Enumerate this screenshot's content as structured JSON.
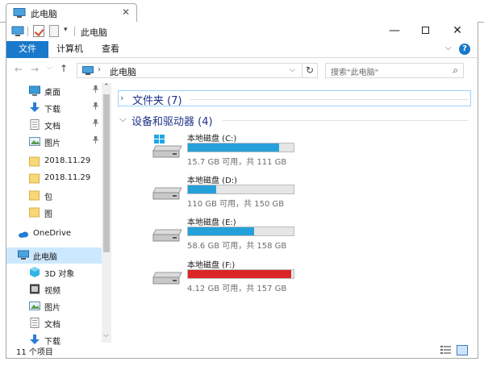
{
  "tab": {
    "title": "此电脑",
    "close": "✕"
  },
  "titlebar": {
    "title": "此电脑",
    "min": "—",
    "close": "✕"
  },
  "ribbon": {
    "tabs": [
      "文件",
      "计算机",
      "查看"
    ],
    "help": "?",
    "collapse": "⌵"
  },
  "address": {
    "back": "←",
    "forward": "→",
    "history": "⌵",
    "up": "↑",
    "separator": "›",
    "path": "此电脑",
    "dropdown": "⌵",
    "refresh": "↻",
    "search_placeholder": "搜索\"此电脑\"",
    "search_icon": "⌕"
  },
  "navpane": {
    "items": [
      {
        "label": "桌面",
        "pinned": true,
        "icon": "desktop-icon"
      },
      {
        "label": "下载",
        "pinned": true,
        "icon": "download-icon"
      },
      {
        "label": "文档",
        "pinned": true,
        "icon": "document-icon"
      },
      {
        "label": "图片",
        "pinned": true,
        "icon": "picture-icon"
      },
      {
        "label": "2018.11.29",
        "pinned": false,
        "icon": "folder-icon"
      },
      {
        "label": "2018.11.29",
        "pinned": false,
        "icon": "folder-icon"
      },
      {
        "label": "包",
        "pinned": false,
        "icon": "folder-icon"
      },
      {
        "label": "图",
        "pinned": false,
        "icon": "folder-icon"
      },
      {
        "label": "OneDrive",
        "pinned": false,
        "icon": "cloud-icon"
      },
      {
        "label": "此电脑",
        "pinned": false,
        "icon": "computer-icon",
        "selected": true
      },
      {
        "label": "3D 对象",
        "pinned": false,
        "icon": "3d-objects-icon"
      },
      {
        "label": "视频",
        "pinned": false,
        "icon": "video-icon"
      },
      {
        "label": "图片",
        "pinned": false,
        "icon": "picture-icon"
      },
      {
        "label": "文档",
        "pinned": false,
        "icon": "document-icon"
      },
      {
        "label": "下载",
        "pinned": false,
        "icon": "download-icon"
      }
    ],
    "pin_glyph": "📌"
  },
  "groups": {
    "folders": {
      "label": "文件夹 (7)",
      "chevron": "›"
    },
    "drives": {
      "label": "设备和驱动器 (4)",
      "chevron": "⌵"
    }
  },
  "drives": [
    {
      "name": "本地磁盘 (C:)",
      "info": "15.7 GB 可用，共 111 GB",
      "used_fraction": 0.859,
      "system": true
    },
    {
      "name": "本地磁盘 (D:)",
      "info": "110 GB 可用，共 150 GB",
      "used_fraction": 0.267,
      "system": false
    },
    {
      "name": "本地磁盘 (E:)",
      "info": "58.6 GB 可用，共 158 GB",
      "used_fraction": 0.629,
      "system": false
    },
    {
      "name": "本地磁盘 (F:)",
      "info": "4.12 GB 可用，共 157 GB",
      "used_fraction": 0.974,
      "system": false,
      "critical": true
    }
  ],
  "status": {
    "text": "11 个项目"
  },
  "colors": {
    "accent": "#1979ca",
    "bar_normal": "#26a0da",
    "bar_full": "#da2626",
    "selection": "#cce8ff"
  }
}
